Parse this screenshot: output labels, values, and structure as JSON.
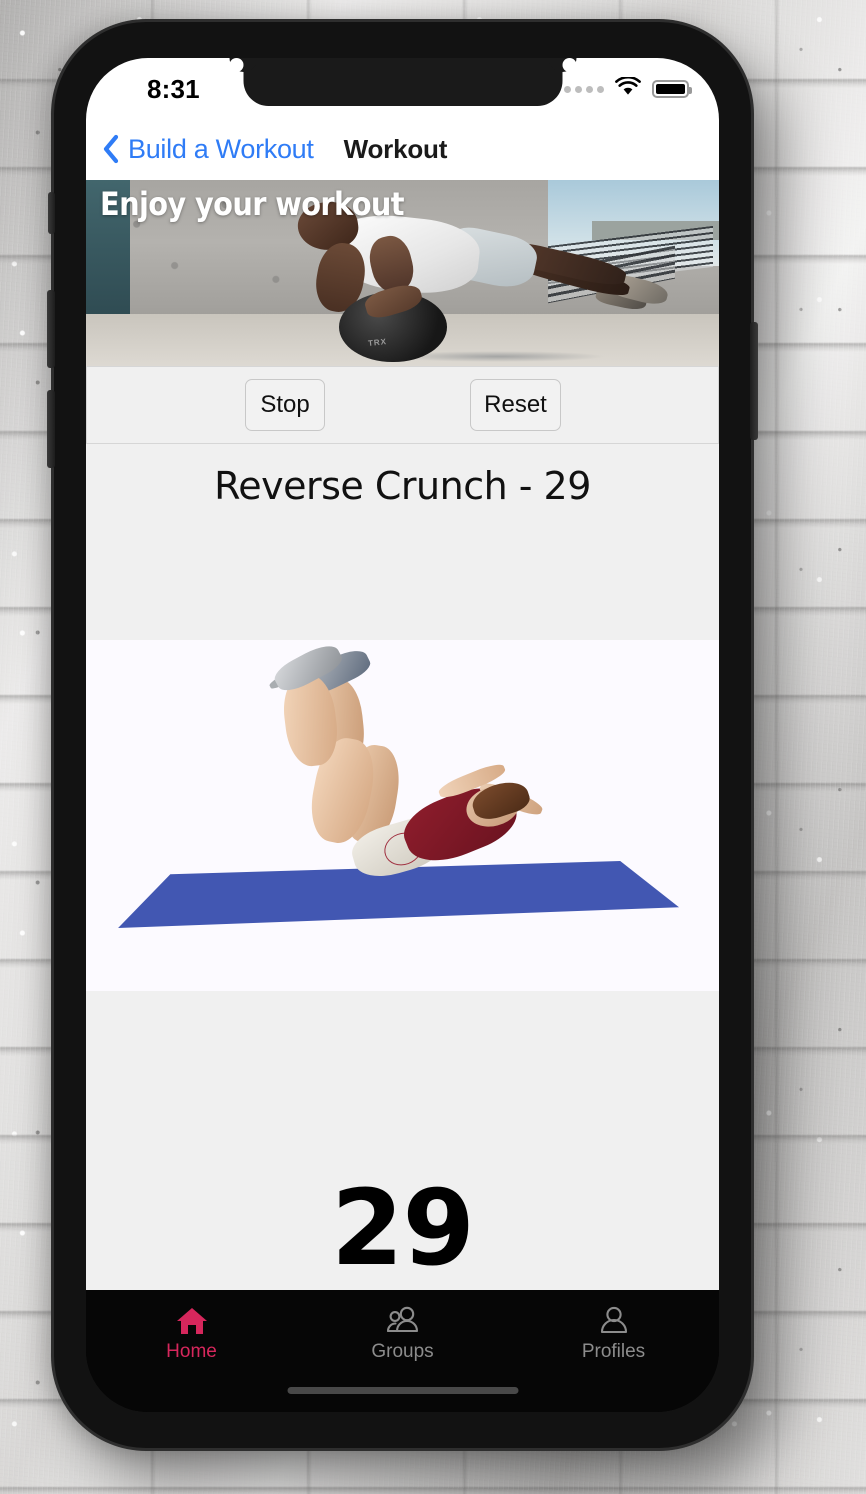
{
  "status_bar": {
    "time": "8:31",
    "signal_icon": "signal-dots-icon",
    "wifi_icon": "wifi-icon",
    "battery_icon": "battery-full-icon"
  },
  "nav_bar": {
    "back_icon": "chevron-left-icon",
    "back_label": "Build a Workout",
    "title": "Workout"
  },
  "hero": {
    "title": "Enjoy your workout",
    "ball_brand": "TRX",
    "image_alt": "athlete-plank-medicine-ball-photo"
  },
  "controls": {
    "stop_label": "Stop",
    "reset_label": "Reset"
  },
  "exercise": {
    "title": "Reverse Crunch - 29",
    "name": "Reverse Crunch",
    "separator": "-",
    "rep_count": "29",
    "illustration_alt": "reverse-crunch-figure-on-blue-mat"
  },
  "counter": {
    "value": "29"
  },
  "tab_bar": {
    "items": [
      {
        "label": "Home",
        "icon": "home-icon",
        "active": true
      },
      {
        "label": "Groups",
        "icon": "people-icon",
        "active": false
      },
      {
        "label": "Profiles",
        "icon": "person-icon",
        "active": false
      }
    ]
  },
  "colors": {
    "accent_pink": "#d6275c",
    "link_blue": "#2f7cf6",
    "panel_gray": "#f0f0f0",
    "mat_blue": "#4257b2",
    "tab_inactive": "#8c8c8c",
    "tabbar_bg": "#060606"
  }
}
